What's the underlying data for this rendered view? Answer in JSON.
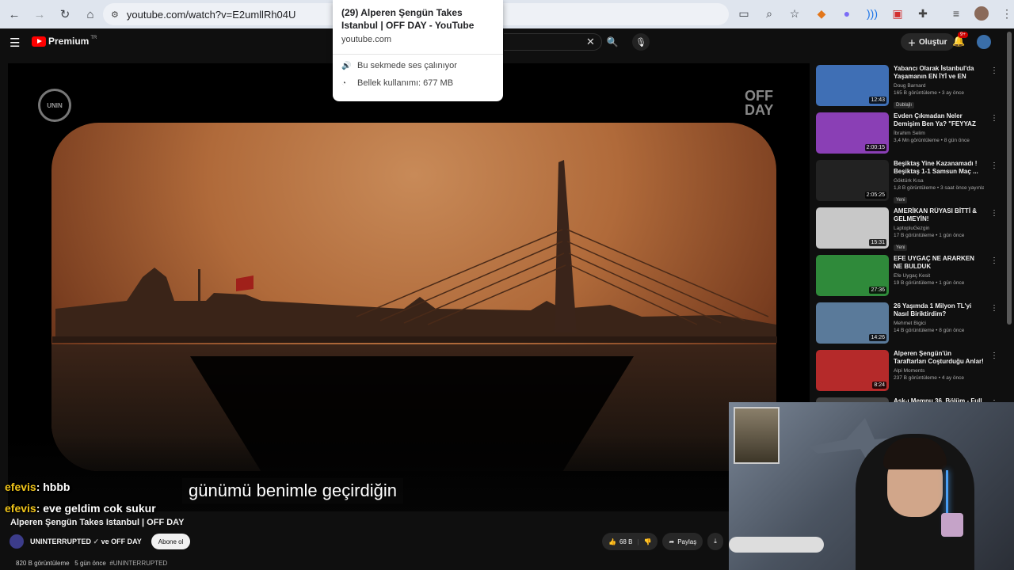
{
  "browser": {
    "url": "youtube.com/watch?v=E2umllRh04U",
    "nav": {
      "back": "←",
      "forward": "→",
      "reload": "↻",
      "home": "⌂"
    },
    "tab_popup": {
      "title": "(29) Alperen Şengün Takes Istanbul | OFF DAY - YouTube",
      "domain": "youtube.com",
      "audio": "Bu sekmede ses çalınıyor",
      "memory": "Bellek kullanımı: 677 MB"
    }
  },
  "youtube": {
    "logo_text": "Premium",
    "logo_region": "TR",
    "create_label": "Oluştur",
    "notif_count": "9+"
  },
  "player": {
    "subtitle": "günümü benimle geçirdiğin",
    "watermark_left": "UNINTERRUPTED",
    "watermark_right": "OFF DAY",
    "chat": [
      {
        "user": "efevis",
        "msg": ": hbbb"
      },
      {
        "user": "efevis",
        "msg": ": eve geldim cok sukur"
      }
    ]
  },
  "video": {
    "title": "Alperen Şengün Takes Istanbul | OFF DAY",
    "channel": "UNINTERRUPTED",
    "channel_collab": "ve OFF DAY",
    "subscribe_label": "Abone ol",
    "likes": "68 B",
    "share_label": "Paylaş",
    "views": "820 B görüntüleme",
    "age": "5 gün önce",
    "tag": "#UNINTERRUPTED"
  },
  "sidebar": [
    {
      "title": "Yabancı Olarak İstanbul'da Yaşamanın EN İYİ ve EN KÖTÜ...",
      "channel": "Doug Barnard",
      "stats": "165 B görüntüleme • 3 ay önce",
      "badge": "Dublajlı",
      "duration": "12:43",
      "color": "#3f6fb5"
    },
    {
      "title": "Evden Çıkmadan Neler Demişim Ben Ya? \"FEYYAZ YİĞİT\" -...",
      "channel": "İbrahim Selim",
      "stats": "3,4 Mn görüntüleme • 8 gün önce",
      "badge": "",
      "duration": "2:00:15",
      "color": "#8a3fb5"
    },
    {
      "title": "Beşiktaş Yine Kazanamadı ! Beşiktaş 1-1 Samsun Maç ...",
      "channel": "Göktürk Kısa",
      "stats": "1,8 B görüntüleme • 3 saat önce yayınlan",
      "badge": "Yeni",
      "duration": "2:05:25",
      "color": "#222"
    },
    {
      "title": "AMERİKAN RÜYASI BİTTİ & GELMEYİN!",
      "channel": "LaptopluGezgin",
      "stats": "17 B görüntüleme • 1 gün önce",
      "badge": "Yeni",
      "duration": "15:31",
      "color": "#c8c8c8"
    },
    {
      "title": "EFE UYGAÇ NE ARARKEN NE BULDUK İNANAMAYACAKSIN ...",
      "channel": "Efe Uygaç Kesit",
      "stats": "19 B görüntüleme • 1 gün önce",
      "badge": "",
      "duration": "27:36",
      "color": "#2f8a3a"
    },
    {
      "title": "26 Yaşımda 1 Milyon TL'yi Nasıl Biriktirdim?",
      "channel": "Mehmet Bigici",
      "stats": "14 B görüntüleme • 8 gün önce",
      "badge": "",
      "duration": "14:26",
      "color": "#5a7a9a"
    },
    {
      "title": "Alperen Şengün'ün Taraftarları Coşturduğu Anlar!",
      "channel": "Alpi Moments",
      "stats": "237 B görüntüleme • 4 ay önce",
      "badge": "",
      "duration": "8:24",
      "color": "#b52a2a"
    },
    {
      "title": "Aşk-ı Memnu 36. Bölüm - Full",
      "channel": "",
      "stats": "",
      "badge": "",
      "duration": "",
      "color": "#444"
    }
  ]
}
